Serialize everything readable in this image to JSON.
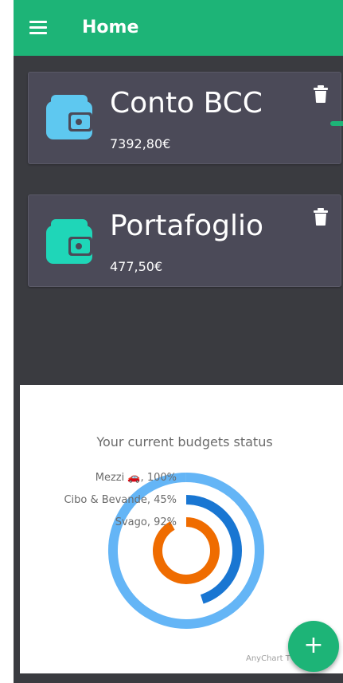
{
  "appbar": {
    "title": "Home"
  },
  "accounts": [
    {
      "name": "Conto BCC",
      "amount": "7392,80€",
      "icon": "wallet-icon",
      "icon_color": "#5ec8f0"
    },
    {
      "name": "Portafoglio",
      "amount": "477,50€",
      "icon": "wallet-icon",
      "icon_color": "#1fd6b8"
    }
  ],
  "colors": {
    "accent": "#1db477",
    "background": "#3a3b40",
    "card": "#4b4a58"
  },
  "chart_data": {
    "type": "radial-bar",
    "title": "Your current budgets status",
    "series": [
      {
        "name": "Mezzi 🚗",
        "label": "Mezzi 🚗, 100%",
        "value": 100,
        "color": "#64b5f6"
      },
      {
        "name": "Cibo & Bevande",
        "label": "Cibo & Bevande, 45%",
        "value": 45,
        "color": "#1976d2"
      },
      {
        "name": "Svago",
        "label": "Svago, 92%",
        "value": 92,
        "color": "#ef6c00"
      }
    ],
    "credits": "AnyChart T"
  },
  "fab": {
    "label": "+"
  }
}
